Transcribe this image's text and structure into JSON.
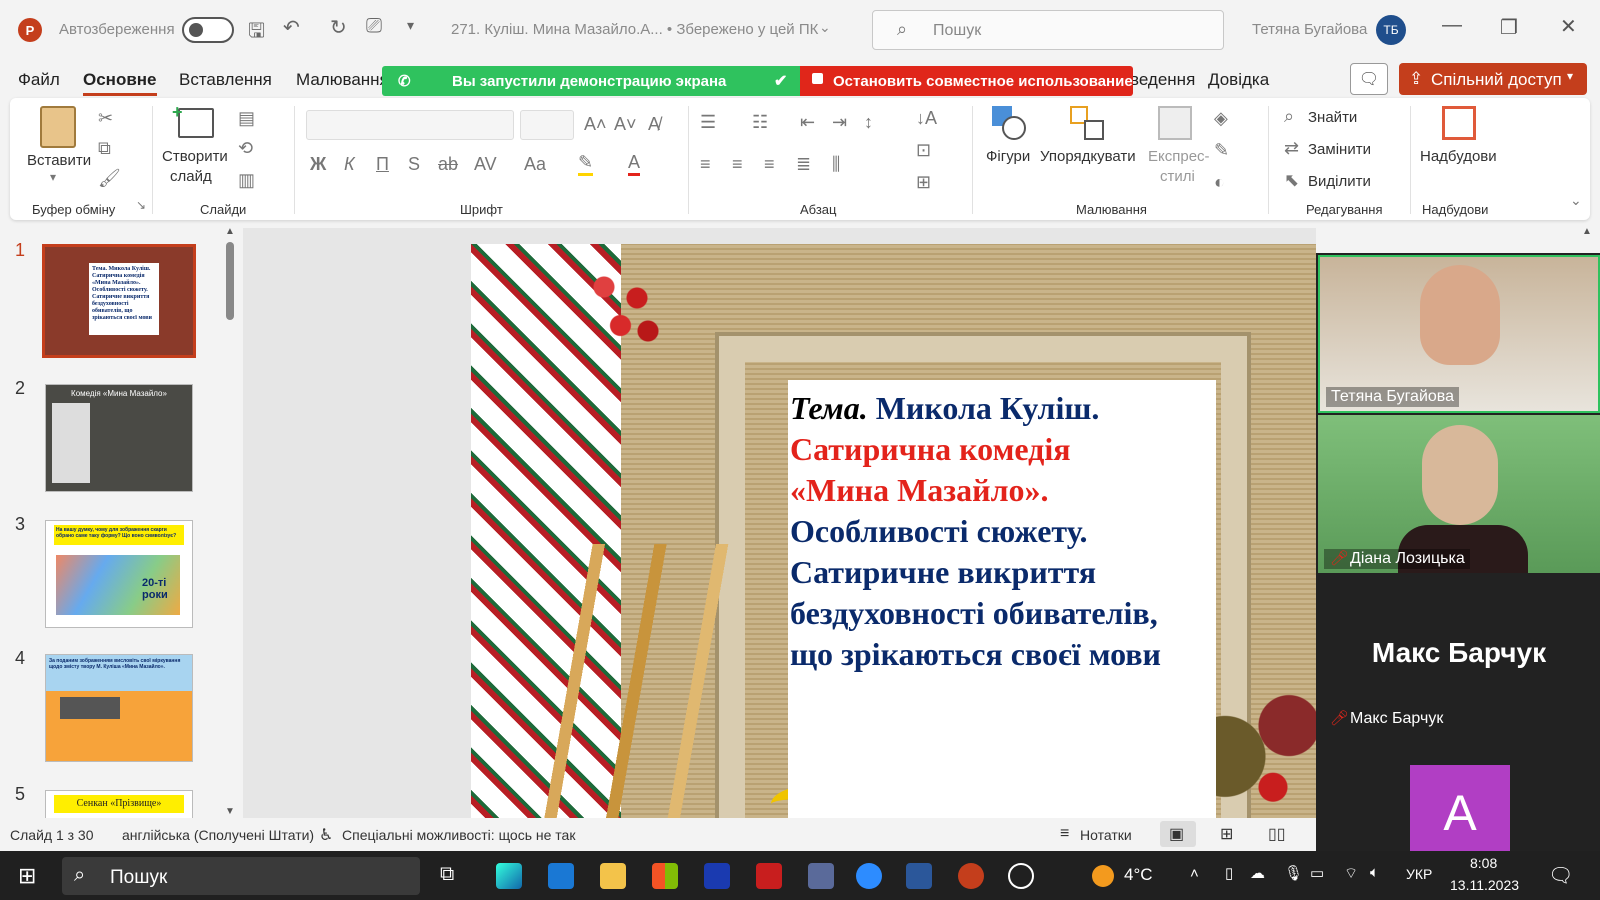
{
  "titlebar": {
    "autosave_label": "Автозбереження",
    "doc_title": "271. Куліш. Мина Мазайло.А...  •  Збережено у цей ПК",
    "search_placeholder": "Пошук",
    "user_name": "Тетяна Бугайова",
    "user_initials": "ТБ"
  },
  "menu": {
    "items": [
      "Файл",
      "Основне",
      "Вставлення",
      "Малювання",
      "ведення",
      "Довідка"
    ],
    "active": "Основне"
  },
  "share_banner": {
    "green_text": "Вы запустили демонстрацию экрана",
    "red_text": "Остановить совместное использование"
  },
  "share_button": "Спільний доступ",
  "ribbon": {
    "clipboard": {
      "paste": "Вставити",
      "group": "Буфер обміну"
    },
    "slides": {
      "new_slide_line1": "Створити",
      "new_slide_line2": "слайд",
      "group": "Слайди"
    },
    "font": {
      "bold": "Ж",
      "italic": "К",
      "underline": "П",
      "shadow": "S",
      "strike": "ab",
      "group": "Шрифт"
    },
    "paragraph": {
      "group": "Абзац"
    },
    "drawing": {
      "shapes": "Фігури",
      "arrange": "Упорядкувати",
      "quick_styles_1": "Експрес-",
      "quick_styles_2": "стилі",
      "group": "Малювання"
    },
    "editing": {
      "find": "Знайти",
      "replace": "Замінити",
      "select": "Виділити",
      "group": "Редагування"
    },
    "addins": {
      "label": "Надбудови",
      "group": "Надбудови"
    }
  },
  "thumbnails": [
    {
      "num": "1",
      "text": "Тема. Микола Куліш. Сатирична комедія «Мина Мазайло». Особливості сюжету. Сатиричне викриття бездуховності обивателів, що зрікаються своєї мови"
    },
    {
      "num": "2",
      "text": "Комедія «Мина Мазайло»"
    },
    {
      "num": "3",
      "text": "На вашу думку, чому для зображення скарги обрано саме таку форму? Що воно символізує?",
      "sub": "20-ті роки"
    },
    {
      "num": "4",
      "text": "За поданим зображенням висловіть свої міркування щодо змісту твору М. Куліша «Мина Мазайло»."
    },
    {
      "num": "5",
      "text": "Сенкан «Прізвище»"
    }
  ],
  "slide": {
    "line1_italic": "Тема.",
    "line1_rest": " Микола Куліш.",
    "line2": "Сатирична комедія",
    "line3": "«Мина Мазайло».",
    "line4": "Особливості сюжету.",
    "line5": "Сатиричне викриття",
    "line6": "бездуховності обивателів,",
    "line7": "що зрікаються своєї мови",
    "colors": {
      "blue": "#0a2a6b",
      "red": "#e3231b"
    }
  },
  "participants": [
    {
      "name": "Тетяна Бугайова",
      "muted": false
    },
    {
      "name": "Діана Лозицька",
      "muted": true
    },
    {
      "name": "Макс Барчук",
      "muted": true,
      "big_label": "Макс Барчук"
    },
    {
      "initial": "A"
    }
  ],
  "status": {
    "slide": "Слайд 1 з 30",
    "language": "англійська (Сполучені Штати)",
    "accessibility": "Спеціальні можливості: щось не так",
    "notes": "Нотатки"
  },
  "taskbar": {
    "search": "Пошук",
    "weather": "4°C",
    "lang": "УКР",
    "time": "8:08",
    "date": "13.11.2023"
  }
}
